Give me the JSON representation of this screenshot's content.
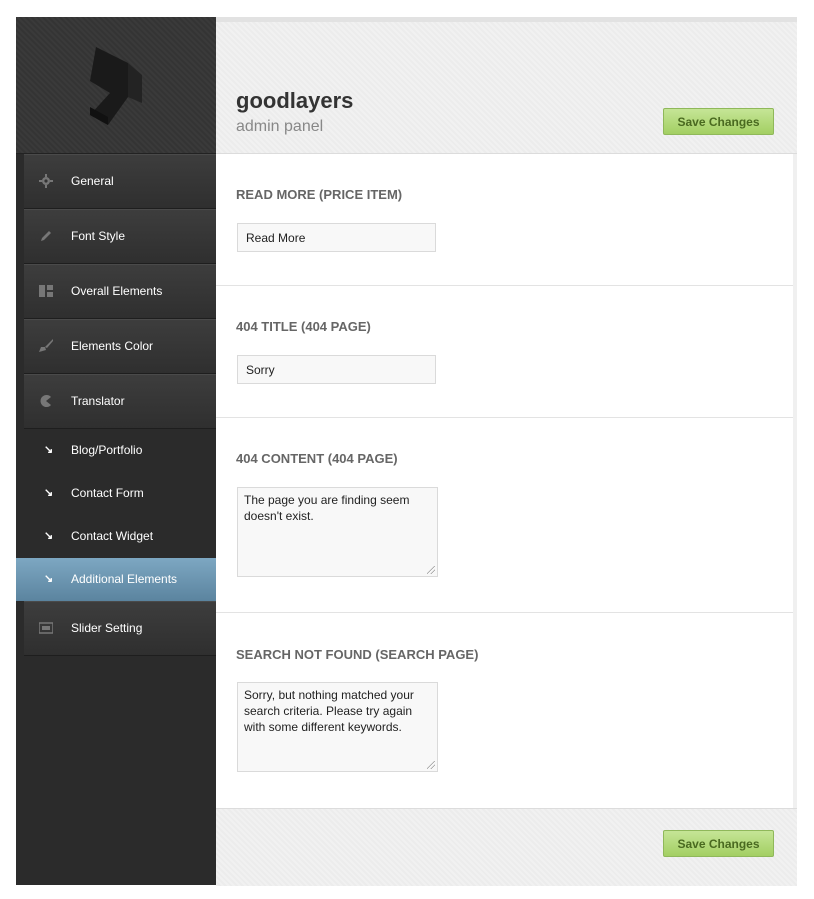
{
  "header": {
    "brand": "goodlayers",
    "subtitle": "admin panel",
    "save_label": "Save Changes"
  },
  "sidebar": {
    "items": [
      {
        "label": "General",
        "icon": "gear-icon"
      },
      {
        "label": "Font Style",
        "icon": "pencil-icon"
      },
      {
        "label": "Overall Elements",
        "icon": "layout-icon"
      },
      {
        "label": "Elements Color",
        "icon": "brush-icon"
      },
      {
        "label": "Translator",
        "icon": "pacman-icon"
      }
    ],
    "subitems": [
      {
        "label": "Blog/Portfolio",
        "arrow": "↘"
      },
      {
        "label": "Contact Form",
        "arrow": "↘"
      },
      {
        "label": "Contact Widget",
        "arrow": "↘"
      },
      {
        "label": "Additional Elements",
        "arrow": "↘",
        "active": true
      }
    ],
    "after": {
      "label": "Slider Setting",
      "icon": "slider-icon"
    }
  },
  "sections": [
    {
      "title": "READ MORE (PRICE ITEM)",
      "value": "Read More"
    },
    {
      "title": "404 TITLE (404 PAGE)",
      "value": "Sorry"
    },
    {
      "title": "404 CONTENT (404 PAGE)",
      "value": "The page you are finding seem doesn't exist."
    },
    {
      "title": "SEARCH NOT FOUND (SEARCH PAGE)",
      "value": "Sorry, but nothing matched your search criteria. Please try again with some different keywords."
    }
  ],
  "footer": {
    "save_label": "Save Changes"
  },
  "colors": {
    "accent_active": "#6f98b3",
    "button_green": "#a3cf63",
    "sidebar_bg": "#2b2b2b"
  }
}
